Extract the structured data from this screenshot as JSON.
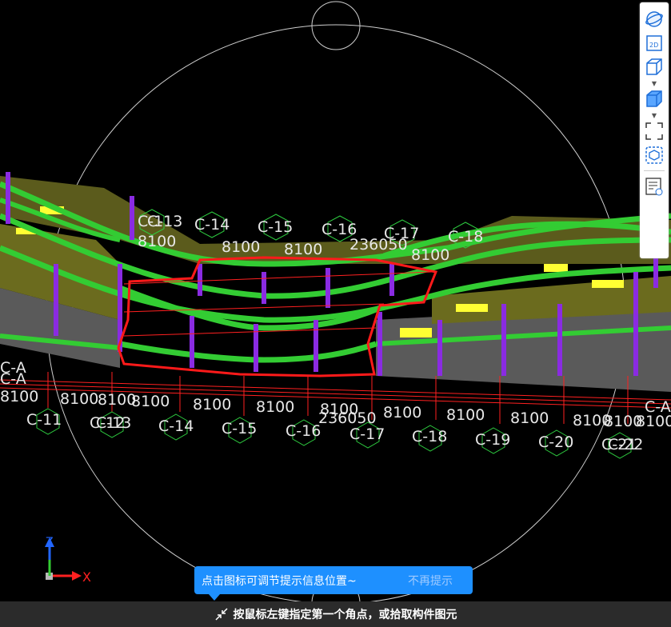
{
  "viewport": {
    "axis_labels_back": [
      "C-11",
      "C-13",
      "C-14",
      "C-15",
      "C-16",
      "C-17",
      "C-18"
    ],
    "dims_back": [
      "8100",
      "8100",
      "8100",
      "236050",
      "8100"
    ],
    "axis_labels_front": [
      "C-11",
      "C-12",
      "C-13",
      "C-14",
      "C-15",
      "C-16",
      "C-17",
      "C-18",
      "C-19",
      "C-20",
      "C-21",
      "C-22"
    ],
    "dims_front": [
      "8100",
      "8100",
      "8100",
      "8100",
      "8100",
      "8100",
      "8100",
      "236050",
      "8100",
      "8100",
      "8100",
      "8100",
      "8100",
      "8100"
    ],
    "row_labels": [
      "C-A",
      "C-A",
      "C-A"
    ],
    "gizmo": {
      "x_label": "X",
      "z_label": "Z"
    }
  },
  "toolbar": {
    "items": [
      {
        "name": "orbit",
        "icon": "orbit-icon"
      },
      {
        "name": "2d",
        "icon": "2d-icon",
        "label": "2D"
      },
      {
        "name": "view-cube-wire",
        "icon": "wire-cube-icon"
      },
      {
        "name": "view-cube-solid",
        "icon": "solid-cube-icon"
      },
      {
        "name": "fit",
        "icon": "fit-frame-icon"
      },
      {
        "name": "section-box",
        "icon": "section-box-icon"
      },
      {
        "name": "properties",
        "icon": "properties-list-icon"
      }
    ]
  },
  "tip": {
    "text": "点击图标可调节提示信息位置~",
    "dismiss": "不再提示"
  },
  "status": {
    "icon": "crosshair-arrows-icon",
    "text": "按鼠标左键指定第一个角点，或拾取构件图元"
  },
  "colors": {
    "background": "#000000",
    "beam": "#2ecc40",
    "column": "#8a2be2",
    "slab": "#6b6b1e",
    "selection": "#ff2020",
    "tip": "#1e90ff",
    "status_bg": "#2b2b2b"
  }
}
